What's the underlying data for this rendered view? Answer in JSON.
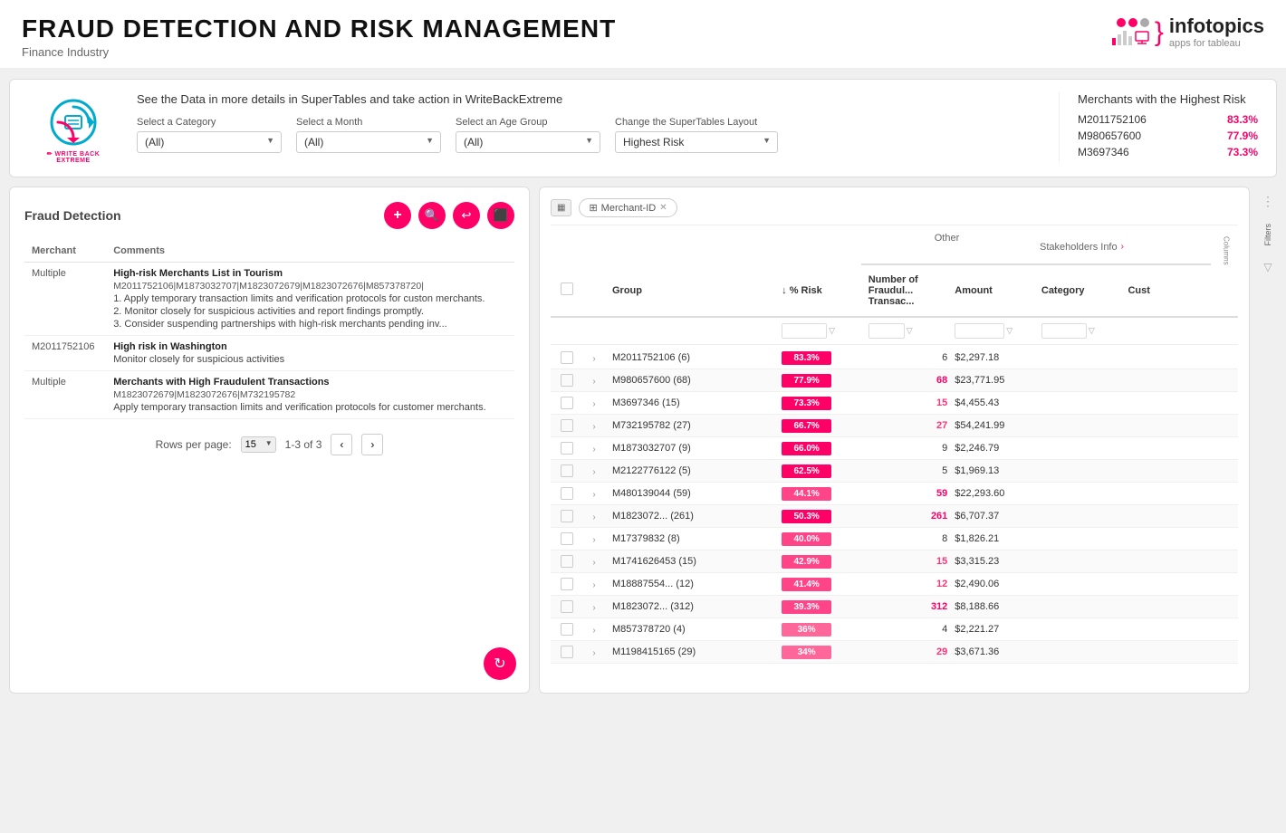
{
  "header": {
    "title": "FRAUD DETECTION AND RISK MANAGEMENT",
    "subtitle": "Finance Industry",
    "logo_brand": "infotopics",
    "logo_tagline": "apps for tableau"
  },
  "filter_bar": {
    "description": "See the Data in more details in SuperTables and take action in WriteBackExtreme",
    "category_label": "Select a Category",
    "category_value": "(All)",
    "month_label": "Select a Month",
    "month_value": "(All)",
    "age_group_label": "Select an Age Group",
    "age_group_value": "(All)",
    "layout_label": "Change the SuperTables Layout",
    "layout_value": "Highest Risk",
    "merchants_title": "Merchants with the Highest Risk",
    "top_merchants": [
      {
        "id": "M2011752106",
        "pct": "83.3%"
      },
      {
        "id": "M980657600",
        "pct": "77.9%"
      },
      {
        "id": "M3697346",
        "pct": "73.3%"
      }
    ]
  },
  "fraud_panel": {
    "title": "Fraud Detection",
    "columns": [
      "Merchant",
      "Comments"
    ],
    "rows": [
      {
        "merchant": "Multiple",
        "comment_title": "High-risk Merchants List in Tourism",
        "comment_ids": "M2011752106|M1873032707|M1823072679|M1823072676|M857378720|",
        "comment_lines": [
          "1. Apply temporary transaction limits and verification protocols for custon merchants.",
          "2. Monitor closely for suspicious activities and report findings promptly.",
          "3. Consider suspending partnerships with high-risk merchants pending inv..."
        ]
      },
      {
        "merchant": "M2011752106",
        "comment_title": "High risk in Washington",
        "comment_ids": "",
        "comment_lines": [
          "Monitor closely for suspicious activities"
        ]
      },
      {
        "merchant": "Multiple",
        "comment_title": "Merchants with High Fraudulent Transactions",
        "comment_ids": "M1823072679|M1823072676|M732195782",
        "comment_lines": [
          "Apply temporary transaction limits and verification protocols for customer merchants."
        ]
      }
    ],
    "pagination": {
      "rows_per_page_label": "Rows per page:",
      "rows_per_page_value": "15",
      "page_info": "1-3 of 3"
    }
  },
  "supertables": {
    "toolbar_icon": "▦",
    "tab_label": "Merchant-ID",
    "section_other": "Other",
    "section_stakeholders": "Stakeholders Info",
    "columns": {
      "group": "Group",
      "risk": "↓ % Risk",
      "fraudulent": "Number of Fraudul... Transac...",
      "amount": "Amount",
      "category": "Category",
      "cust": "Cust"
    },
    "rows": [
      {
        "group": "M2011752106 (6)",
        "risk_pct": "83.3%",
        "risk_color": "#ff0066",
        "fraudulent": 6,
        "amount": "$2,297.18",
        "category": "",
        "cust": ""
      },
      {
        "group": "M980657600 (68)",
        "risk_pct": "77.9%",
        "risk_color": "#ff0066",
        "fraudulent": 68,
        "amount": "$23,771.95",
        "category": "",
        "cust": ""
      },
      {
        "group": "M3697346 (15)",
        "risk_pct": "73.3%",
        "risk_color": "#ff0066",
        "fraudulent": 15,
        "amount": "$4,455.43",
        "category": "",
        "cust": ""
      },
      {
        "group": "M732195782 (27)",
        "risk_pct": "66.7%",
        "risk_color": "#ff0066",
        "fraudulent": 27,
        "amount": "$54,241.99",
        "category": "",
        "cust": ""
      },
      {
        "group": "M1873032707 (9)",
        "risk_pct": "66.0%",
        "risk_color": "#ff0066",
        "fraudulent": 9,
        "amount": "$2,246.79",
        "category": "",
        "cust": ""
      },
      {
        "group": "M2122776122 (5)",
        "risk_pct": "62.5%",
        "risk_color": "#ff0066",
        "fraudulent": 5,
        "amount": "$1,969.13",
        "category": "",
        "cust": ""
      },
      {
        "group": "M480139044 (59)",
        "risk_pct": "44.1%",
        "risk_color": "#ff4488",
        "fraudulent": 59,
        "amount": "$22,293.60",
        "category": "",
        "cust": ""
      },
      {
        "group": "M1823072... (261)",
        "risk_pct": "50.3%",
        "risk_color": "#ff0066",
        "fraudulent": 261,
        "amount": "$6,707.37",
        "category": "",
        "cust": ""
      },
      {
        "group": "M17379832 (8)",
        "risk_pct": "40.0%",
        "risk_color": "#ff4488",
        "fraudulent": 8,
        "amount": "$1,826.21",
        "category": "",
        "cust": ""
      },
      {
        "group": "M1741626453 (15)",
        "risk_pct": "42.9%",
        "risk_color": "#ff4488",
        "fraudulent": 15,
        "amount": "$3,315.23",
        "category": "",
        "cust": ""
      },
      {
        "group": "M18887554... (12)",
        "risk_pct": "41.4%",
        "risk_color": "#ff4488",
        "fraudulent": 12,
        "amount": "$2,490.06",
        "category": "",
        "cust": ""
      },
      {
        "group": "M1823072... (312)",
        "risk_pct": "39.3%",
        "risk_color": "#ff4488",
        "fraudulent": 312,
        "amount": "$8,188.66",
        "category": "",
        "cust": ""
      },
      {
        "group": "M857378720 (4)",
        "risk_pct": "36%",
        "risk_color": "#ff6699",
        "fraudulent": 4,
        "amount": "$2,221.27",
        "category": "",
        "cust": ""
      },
      {
        "group": "M1198415165 (29)",
        "risk_pct": "34%",
        "risk_color": "#ff6699",
        "fraudulent": 29,
        "amount": "$3,671.36",
        "category": "",
        "cust": ""
      }
    ]
  }
}
